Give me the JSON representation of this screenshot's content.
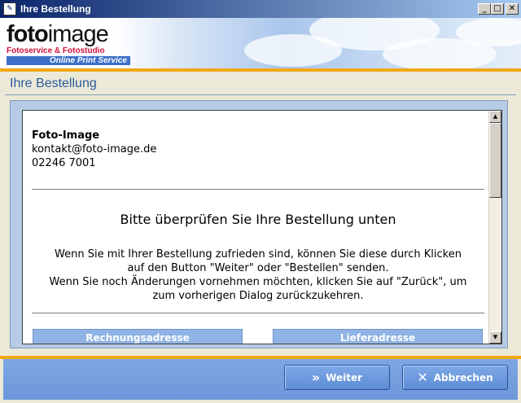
{
  "window": {
    "title": "Ihre Bestellung",
    "controls": [
      "_",
      "□",
      "✕"
    ]
  },
  "banner": {
    "logo_bold": "foto",
    "logo_light": "image",
    "tagline": "Fotoservice & Fotostudio",
    "service": "Online Print Service"
  },
  "page": {
    "title": "Ihre Bestellung"
  },
  "company": {
    "name": "Foto-Image",
    "email": "kontakt@foto-image.de",
    "phone": "02246 7001"
  },
  "review": {
    "heading": "Bitte überprüfen Sie Ihre Bestellung unten",
    "line1": "Wenn Sie mit Ihrer Bestellung zufrieden sind, können Sie diese durch Klicken",
    "line2": "auf den Button \"Weiter\" oder \"Bestellen\" senden.",
    "line3": "Wenn Sie noch Änderungen vornehmen möchten, klicken Sie auf \"Zurück\", um",
    "line4": "zum vorherigen Dialog zurückzukehren."
  },
  "addresses": {
    "billing_label": "Rechnungsadresse",
    "shipping_label": "Lieferadresse"
  },
  "footer": {
    "next_label": "Weiter",
    "cancel_label": "Abbrechen"
  }
}
